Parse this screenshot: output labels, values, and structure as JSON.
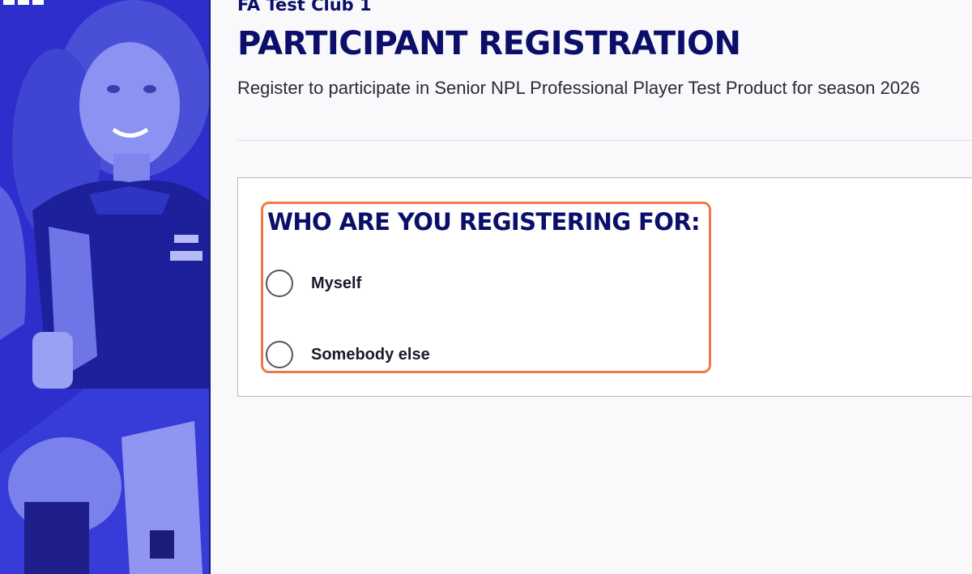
{
  "header": {
    "club_name": "FA Test Club 1",
    "title": "PARTICIPANT REGISTRATION",
    "subtitle": "Register to participate in Senior NPL Professional Player Test Product for season 2026"
  },
  "form": {
    "question": "WHO ARE YOU REGISTERING FOR:",
    "options": [
      {
        "label": "Myself",
        "selected": false
      },
      {
        "label": "Somebody else",
        "selected": false
      }
    ]
  },
  "colors": {
    "brand_navy": "#0b0f6a",
    "sidebar_blue": "#2a2bc4",
    "highlight": "#f07a44"
  }
}
